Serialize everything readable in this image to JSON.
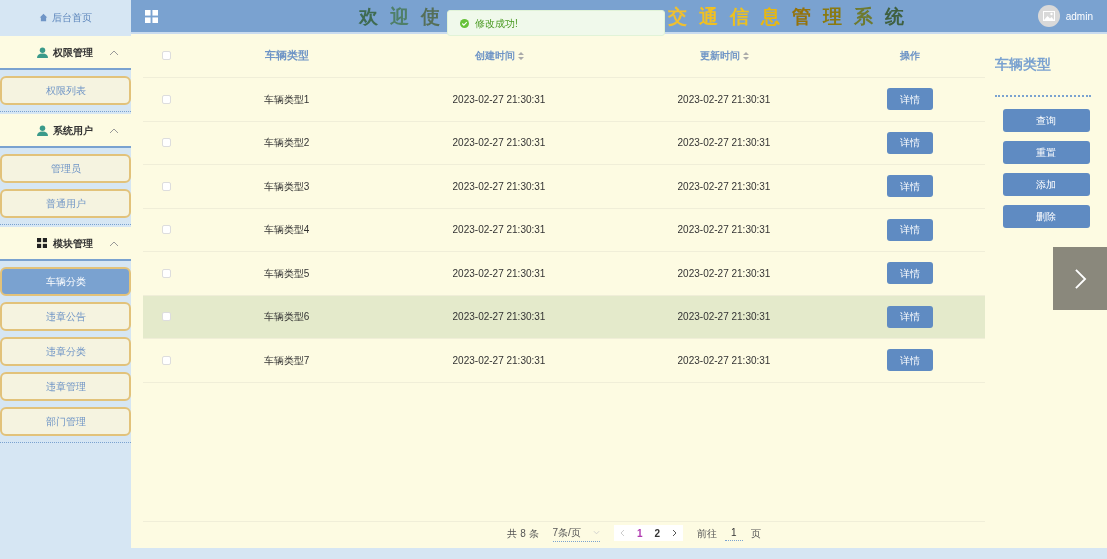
{
  "sidebar": {
    "home": "后台首页",
    "groups": [
      {
        "title": "权限管理",
        "expanded": true,
        "items": [
          {
            "label": "权限列表",
            "selected": false
          }
        ]
      },
      {
        "title": "系统用户",
        "expanded": true,
        "items": [
          {
            "label": "管理员",
            "selected": false
          },
          {
            "label": "普通用户",
            "selected": false
          }
        ]
      },
      {
        "title": "模块管理",
        "expanded": true,
        "items": [
          {
            "label": "车辆分类",
            "selected": true
          },
          {
            "label": "违章公告",
            "selected": false
          },
          {
            "label": "违章分类",
            "selected": false
          },
          {
            "label": "违章管理",
            "selected": false
          },
          {
            "label": "部门管理",
            "selected": false
          }
        ]
      }
    ]
  },
  "header": {
    "title_start": [
      {
        "char": "欢",
        "color": "#3f6b52"
      },
      {
        "char": "迎",
        "color": "#4f7f68"
      },
      {
        "char": "使",
        "color": "#556f58"
      }
    ],
    "title_end": [
      {
        "char": "交",
        "color": "#f0c030"
      },
      {
        "char": "通",
        "color": "#f2c020"
      },
      {
        "char": "信",
        "color": "#ecc020"
      },
      {
        "char": "息",
        "color": "#e8b810"
      },
      {
        "char": "管",
        "color": "#94720a"
      },
      {
        "char": "理",
        "color": "#8a7a10"
      },
      {
        "char": "系",
        "color": "#6e7a30"
      },
      {
        "char": "统",
        "color": "#3f6040"
      }
    ],
    "user": "admin"
  },
  "toast": {
    "message": "修改成功!"
  },
  "table": {
    "columns": [
      {
        "label": "车辆类型",
        "sortable": false
      },
      {
        "label": "创建时间",
        "sortable": true
      },
      {
        "label": "更新时间",
        "sortable": true
      },
      {
        "label": "操作",
        "sortable": false
      }
    ],
    "header_checked": false,
    "rows": [
      {
        "checked": false,
        "hovered": false,
        "cells": [
          "车辆类型1",
          "2023-02-27 21:30:31",
          "2023-02-27 21:30:31"
        ],
        "action": "详情"
      },
      {
        "checked": false,
        "hovered": false,
        "cells": [
          "车辆类型2",
          "2023-02-27 21:30:31",
          "2023-02-27 21:30:31"
        ],
        "action": "详情"
      },
      {
        "checked": false,
        "hovered": false,
        "cells": [
          "车辆类型3",
          "2023-02-27 21:30:31",
          "2023-02-27 21:30:31"
        ],
        "action": "详情"
      },
      {
        "checked": false,
        "hovered": false,
        "cells": [
          "车辆类型4",
          "2023-02-27 21:30:31",
          "2023-02-27 21:30:31"
        ],
        "action": "详情"
      },
      {
        "checked": false,
        "hovered": false,
        "cells": [
          "车辆类型5",
          "2023-02-27 21:30:31",
          "2023-02-27 21:30:31"
        ],
        "action": "详情"
      },
      {
        "checked": false,
        "hovered": true,
        "cells": [
          "车辆类型6",
          "2023-02-27 21:30:31",
          "2023-02-27 21:30:31"
        ],
        "action": "详情"
      },
      {
        "checked": false,
        "hovered": false,
        "cells": [
          "车辆类型7",
          "2023-02-27 21:30:31",
          "2023-02-27 21:30:31"
        ],
        "action": "详情"
      }
    ]
  },
  "pagination": {
    "total": "共 8 条",
    "page_size": "7条/页",
    "pages": [
      {
        "label": "1",
        "selected": true
      },
      {
        "label": "2",
        "selected": false
      }
    ],
    "goto_label": "前往",
    "goto_value": "1",
    "goto_suffix": "页"
  },
  "side_panel": {
    "title": "车辆类型",
    "buttons": [
      "查询",
      "重置",
      "添加",
      "删除"
    ]
  }
}
